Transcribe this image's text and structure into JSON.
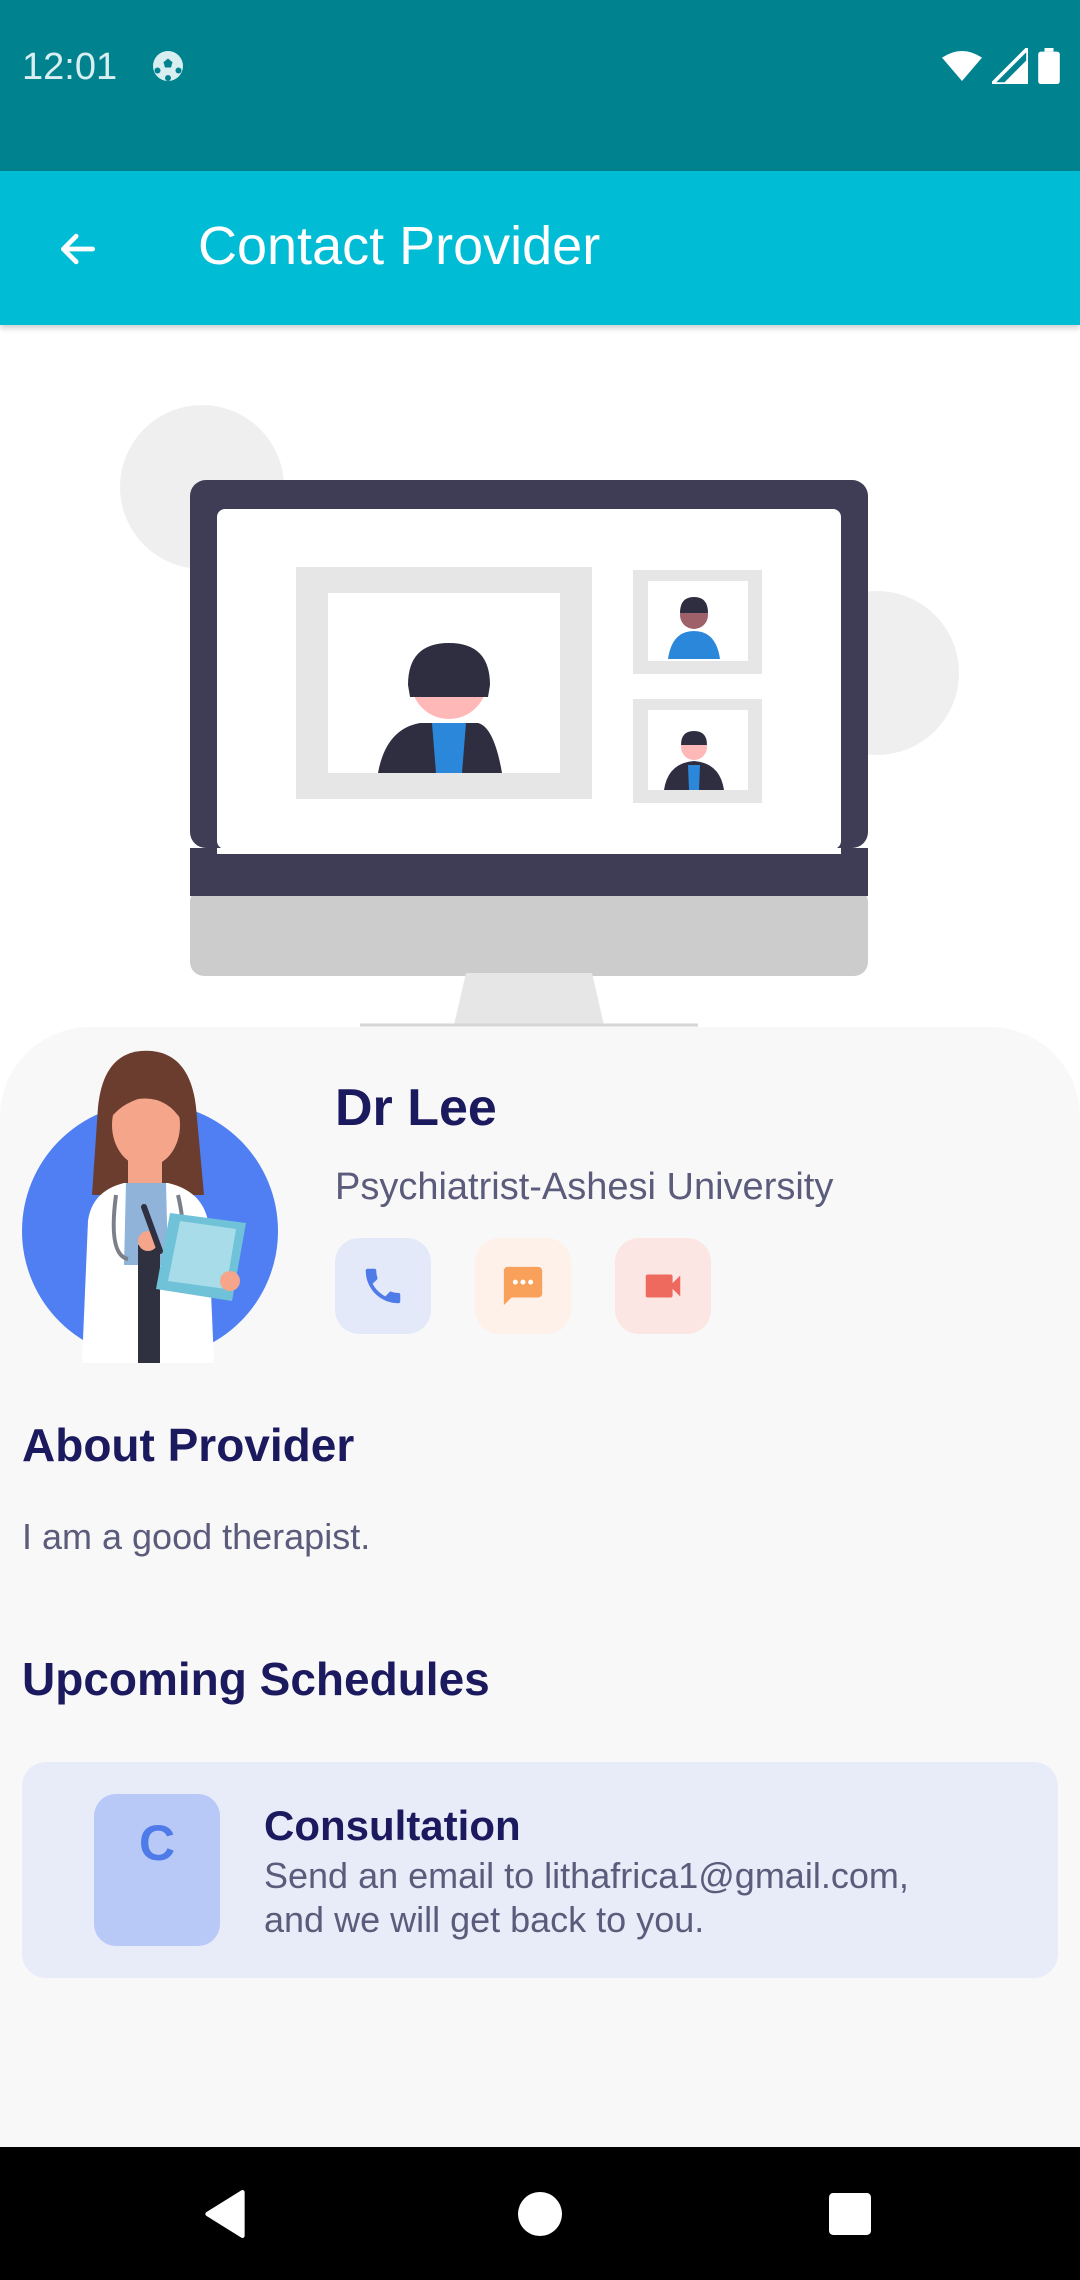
{
  "status_bar": {
    "time": "12:01",
    "icons": [
      "soccer-ball-icon",
      "wifi-icon",
      "cell-signal-icon",
      "battery-icon"
    ]
  },
  "app_bar": {
    "back_icon": "arrow-left-icon",
    "title": "Contact Provider"
  },
  "provider": {
    "name": "Dr Lee",
    "title": "Psychiatrist-Ashesi University",
    "actions": [
      {
        "icon": "phone-icon",
        "color": "#4e7be8"
      },
      {
        "icon": "chat-icon",
        "color": "#f9a15a"
      },
      {
        "icon": "video-icon",
        "color": "#ef6a5e"
      }
    ]
  },
  "about": {
    "heading": "About Provider",
    "text": "I am a good therapist."
  },
  "schedules": {
    "heading": "Upcoming Schedules",
    "items": [
      {
        "badge": "C",
        "title": "Consultation",
        "description": "Send an email to lithafrica1@gmail.com,\n and we will get back to you."
      }
    ]
  },
  "nav_bar": {
    "icons": [
      "back-triangle-icon",
      "home-circle-icon",
      "recents-square-icon"
    ]
  },
  "colors": {
    "status_bar": "#00838f",
    "app_bar": "#00bcd4",
    "heading_text": "#1c1a5e",
    "body_text": "#5b5b7b",
    "schedule_card": "#e8ecf8"
  }
}
